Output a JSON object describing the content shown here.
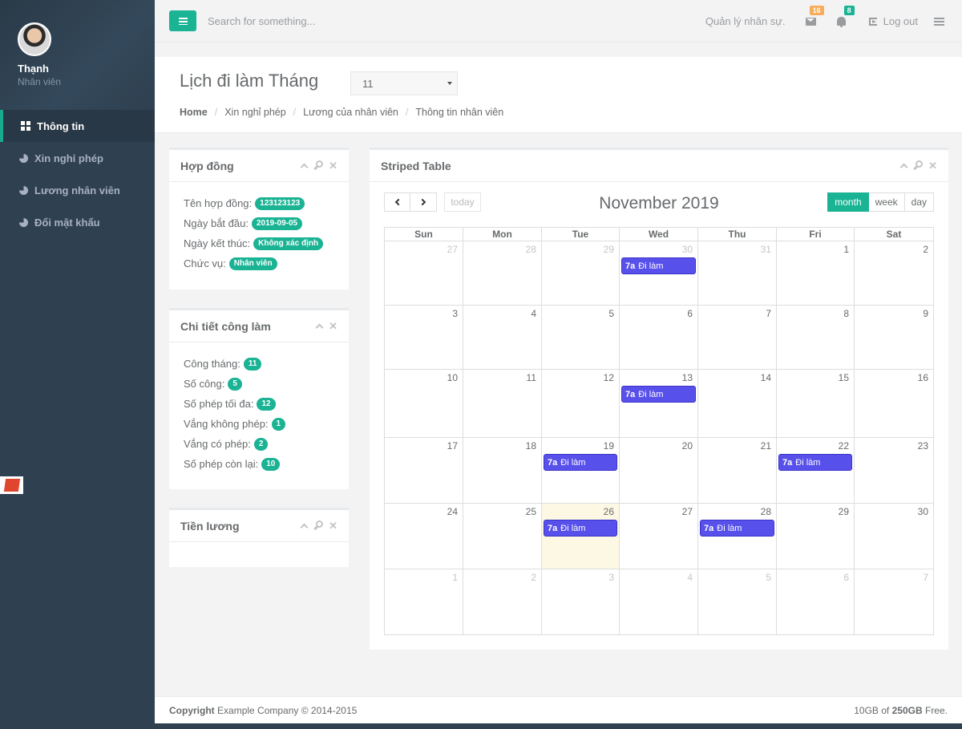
{
  "profile": {
    "name": "Thạnh",
    "role": "Nhân viên"
  },
  "nav": [
    {
      "label": "Thông tin",
      "icon": "grid-icon",
      "active": true
    },
    {
      "label": "Xin nghỉ phép",
      "icon": "pie-chart-icon"
    },
    {
      "label": "Lương nhân viên",
      "icon": "pie-chart-icon"
    },
    {
      "label": "Đổi mật khẩu",
      "icon": "pie-chart-icon"
    }
  ],
  "topbar": {
    "search_placeholder": "Search for something...",
    "welcome": "Quản lý nhân sự.",
    "messages_count": "16",
    "alerts_count": "8",
    "logout": "Log out"
  },
  "heading": {
    "title": "Lịch đi làm Tháng",
    "month_value": "11",
    "breadcrumb": [
      "Home",
      "Xin nghỉ phép",
      "Lương của nhân viên",
      "Thông tin nhân viên"
    ]
  },
  "contract": {
    "title": "Hợp đồng",
    "rows": [
      {
        "label": "Tên hợp đồng:",
        "value": "123123123"
      },
      {
        "label": "Ngày bắt đầu:",
        "value": "2019-09-05"
      },
      {
        "label": "Ngày kết thúc:",
        "value": "Không xác định"
      },
      {
        "label": "Chức vụ:",
        "value": "Nhân viên"
      }
    ]
  },
  "work_detail": {
    "title": "Chi tiết công làm",
    "rows": [
      {
        "label": "Công tháng:",
        "value": "11"
      },
      {
        "label": "Số công:",
        "value": "5"
      },
      {
        "label": "Số phép tối đa:",
        "value": "12"
      },
      {
        "label": "Vắng không phép:",
        "value": "1"
      },
      {
        "label": "Vắng có phép:",
        "value": "2"
      },
      {
        "label": "Số phép còn lại:",
        "value": "10"
      }
    ]
  },
  "salary": {
    "title": "Tiền lương"
  },
  "calendar": {
    "panel_title": "Striped Table",
    "today_label": "today",
    "title": "November 2019",
    "views": [
      "month",
      "week",
      "day"
    ],
    "active_view": "month",
    "weekdays": [
      "Sun",
      "Mon",
      "Tue",
      "Wed",
      "Thu",
      "Fri",
      "Sat"
    ],
    "weeks": [
      [
        {
          "d": "27",
          "o": true
        },
        {
          "d": "28",
          "o": true
        },
        {
          "d": "29",
          "o": true
        },
        {
          "d": "30",
          "o": true,
          "ev": true
        },
        {
          "d": "31",
          "o": true
        },
        {
          "d": "1"
        },
        {
          "d": "2"
        }
      ],
      [
        {
          "d": "3"
        },
        {
          "d": "4"
        },
        {
          "d": "5"
        },
        {
          "d": "6"
        },
        {
          "d": "7"
        },
        {
          "d": "8"
        },
        {
          "d": "9"
        }
      ],
      [
        {
          "d": "10"
        },
        {
          "d": "11"
        },
        {
          "d": "12"
        },
        {
          "d": "13",
          "ev": true
        },
        {
          "d": "14"
        },
        {
          "d": "15"
        },
        {
          "d": "16"
        }
      ],
      [
        {
          "d": "17"
        },
        {
          "d": "18"
        },
        {
          "d": "19",
          "ev": true
        },
        {
          "d": "20"
        },
        {
          "d": "21"
        },
        {
          "d": "22",
          "ev": true
        },
        {
          "d": "23"
        }
      ],
      [
        {
          "d": "24"
        },
        {
          "d": "25"
        },
        {
          "d": "26",
          "today": true,
          "ev": true
        },
        {
          "d": "27"
        },
        {
          "d": "28",
          "ev": true
        },
        {
          "d": "29"
        },
        {
          "d": "30"
        }
      ],
      [
        {
          "d": "1",
          "o": true
        },
        {
          "d": "2",
          "o": true
        },
        {
          "d": "3",
          "o": true
        },
        {
          "d": "4",
          "o": true
        },
        {
          "d": "5",
          "o": true
        },
        {
          "d": "6",
          "o": true
        },
        {
          "d": "7",
          "o": true
        }
      ]
    ],
    "event": {
      "time": "7a",
      "title": "Đi làm"
    }
  },
  "footer": {
    "copyright_bold": "Copyright",
    "copyright_rest": "Example Company © 2014-2015",
    "storage_used": "10GB of",
    "storage_total": "250GB",
    "storage_suffix": "Free."
  }
}
